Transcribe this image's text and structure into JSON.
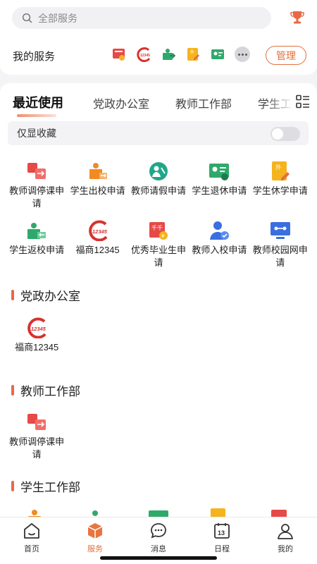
{
  "search": {
    "placeholder": "全部服务"
  },
  "my_services": {
    "title": "我的服务",
    "icons": [
      "certificate-icon",
      "fushang-12345-icon",
      "return-school-icon",
      "suspension-icon",
      "withdraw-icon"
    ],
    "manage_label": "管理"
  },
  "tabs": [
    "最近使用",
    "党政办公室",
    "教师工作部",
    "学生工"
  ],
  "favorites_only": {
    "label": "仅显收藏",
    "enabled": false
  },
  "recent": [
    {
      "label": "教师调停课申请",
      "icon": "teacher-swap-icon"
    },
    {
      "label": "学生出校申请",
      "icon": "student-exit-icon"
    },
    {
      "label": "教师请假申请",
      "icon": "teacher-leave-icon"
    },
    {
      "label": "学生退休申请",
      "icon": "student-withdraw-icon"
    },
    {
      "label": "学生休学申请",
      "icon": "student-suspension-icon"
    },
    {
      "label": "学生返校申请",
      "icon": "student-return-icon"
    },
    {
      "label": "福商12345",
      "icon": "fushang-12345-icon"
    },
    {
      "label": "优秀毕业生申请",
      "icon": "graduate-award-icon"
    },
    {
      "label": "教师入校申请",
      "icon": "teacher-entry-icon"
    },
    {
      "label": "教师校园网申请",
      "icon": "campus-network-icon"
    }
  ],
  "sections": [
    {
      "title": "党政办公室",
      "items": [
        {
          "label": "福商12345",
          "icon": "fushang-12345-icon"
        }
      ]
    },
    {
      "title": "教师工作部",
      "items": [
        {
          "label": "教师调停课申请",
          "icon": "teacher-swap-icon"
        }
      ]
    },
    {
      "title": "学生工作部",
      "items": []
    }
  ],
  "tabbar": [
    {
      "label": "首页",
      "icon": "home-icon",
      "active": false
    },
    {
      "label": "服务",
      "icon": "service-box-icon",
      "active": true
    },
    {
      "label": "消息",
      "icon": "message-icon",
      "active": false
    },
    {
      "label": "日程",
      "icon": "calendar-icon",
      "active": false
    },
    {
      "label": "我的",
      "icon": "profile-icon",
      "active": false
    }
  ],
  "calendar_day": "13",
  "colors": {
    "accent": "#e2703c",
    "red": "#e64a47",
    "orange": "#f08a24",
    "teal": "#22a68a",
    "green": "#2fa96b",
    "blue": "#3a6fe0",
    "yellow": "#f5b41e"
  }
}
